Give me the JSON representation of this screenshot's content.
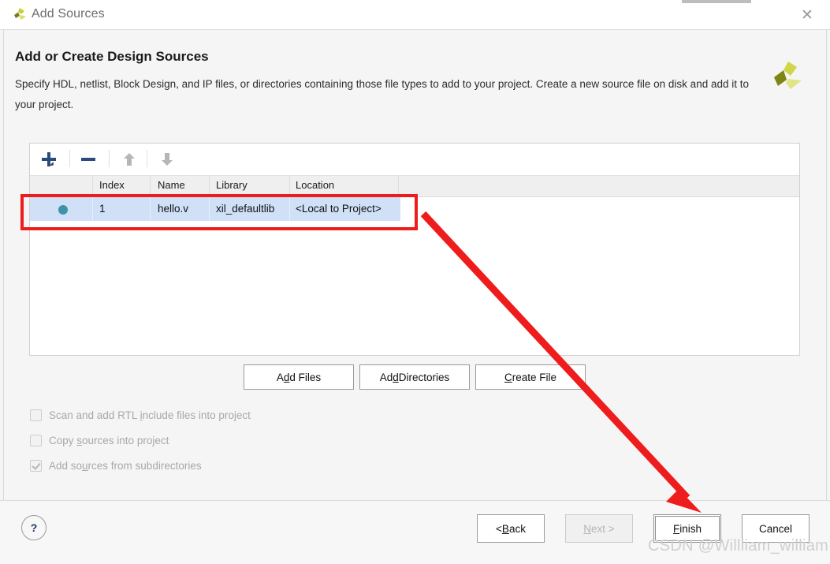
{
  "window": {
    "title": "Add Sources",
    "logo_icon": "xilinx-logo-icon",
    "close_icon": "close-icon"
  },
  "header": {
    "heading": "Add or Create Design Sources",
    "description": "Specify HDL, netlist, Block Design, and IP files, or directories containing those file types to add to your project. Create a new source file on disk and add it to your project.",
    "brand_icon": "xilinx-logo-icon"
  },
  "toolbar": {
    "add_icon": "plus-icon",
    "remove_icon": "minus-icon",
    "move_up_icon": "arrow-up-icon",
    "move_down_icon": "arrow-down-icon",
    "add_dropdown_icon": "dropdown-triangle-icon"
  },
  "table": {
    "columns": [
      "",
      "Index",
      "Name",
      "Library",
      "Location"
    ],
    "rows": [
      {
        "status_icon": "source-status-dot",
        "index": "1",
        "name": "hello.v",
        "library": "xil_defaultlib",
        "location": "<Local to Project>"
      }
    ]
  },
  "actions": {
    "add_files": {
      "pre": "A",
      "mn": "d",
      "post": "d Files"
    },
    "add_directories": {
      "pre": "Ad",
      "mn": "d",
      "post": " Directories"
    },
    "create_file": {
      "pre": "",
      "mn": "C",
      "post": "reate File"
    }
  },
  "options": [
    {
      "pre": "Scan and add RTL ",
      "mn": "i",
      "post": "nclude files into project",
      "checked": false,
      "enabled": false
    },
    {
      "pre": "Copy ",
      "mn": "s",
      "post": "ources into project",
      "checked": false,
      "enabled": false
    },
    {
      "pre": "Add so",
      "mn": "u",
      "post": "rces from subdirectories",
      "checked": true,
      "enabled": false
    }
  ],
  "footer": {
    "help_label": "?",
    "back": {
      "pre": "< ",
      "mn": "B",
      "post": "ack"
    },
    "next": {
      "pre": "",
      "mn": "N",
      "post": "ext >"
    },
    "finish": {
      "pre": "",
      "mn": "F",
      "post": "inish"
    },
    "cancel": {
      "pre": "",
      "mn": "",
      "post": "Cancel"
    }
  },
  "annotation": {
    "highlight_color": "#ee1c1c",
    "arrow_color": "#ee1c1c",
    "watermark": "CSDN @Willliam_william"
  },
  "colors": {
    "selection": "#cfe0f7",
    "status_dot": "#3d93a8",
    "toolbar_icon": "#2b4a7d",
    "toolbar_icon_disabled": "#b6b6b6",
    "help_icon": "#1f3864"
  }
}
